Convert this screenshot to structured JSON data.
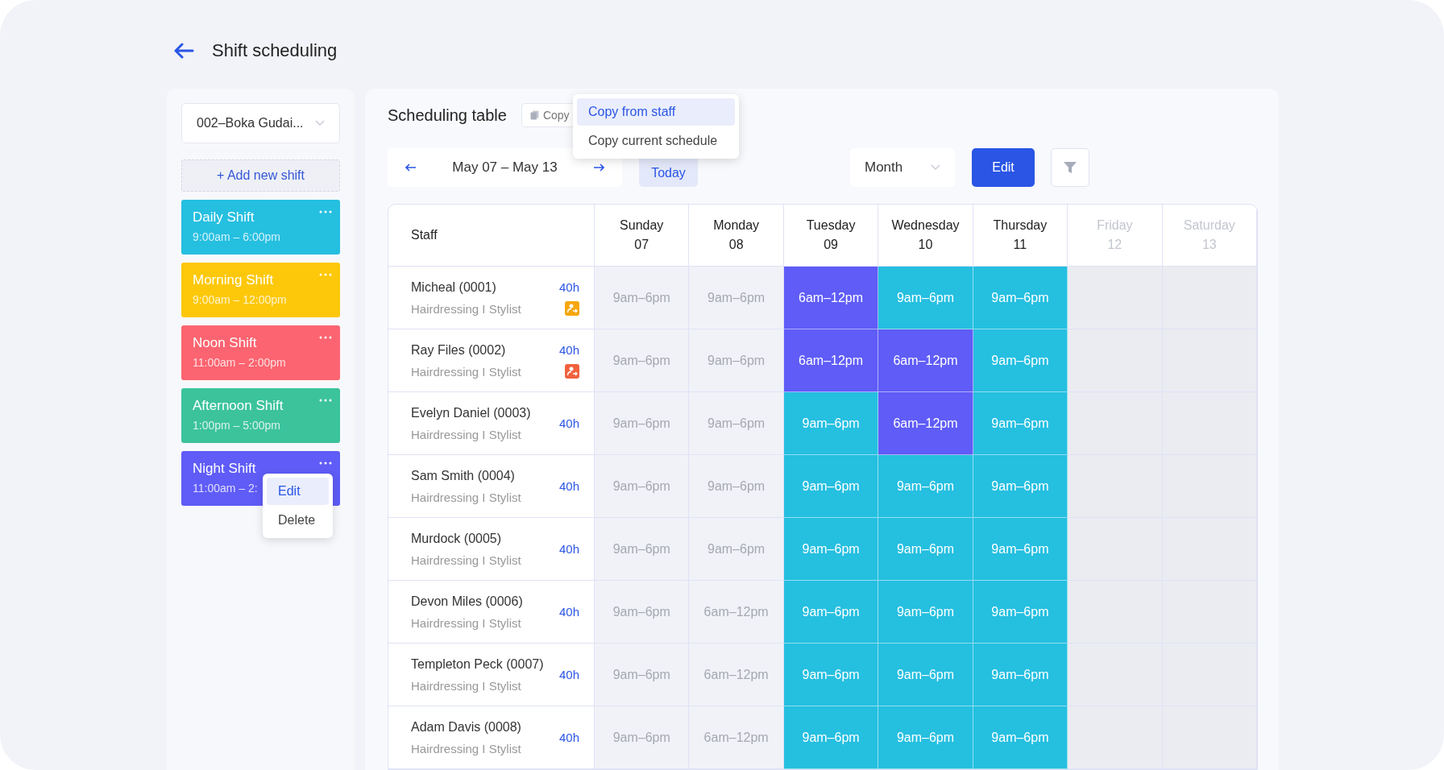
{
  "header": {
    "title": "Shift scheduling"
  },
  "sidebar": {
    "store_select": "002–Boka Gudai...",
    "add_button": "+ Add new shift",
    "shifts": [
      {
        "name": "Daily Shift",
        "time": "9:00am – 6:00pm",
        "color": "#25bfe0"
      },
      {
        "name": "Morning Shift",
        "time": "9:00am – 12:00pm",
        "color": "#fdc80a"
      },
      {
        "name": "Noon Shift",
        "time": "11:00am – 2:00pm",
        "color": "#fb6470"
      },
      {
        "name": "Afternoon Shift",
        "time": "1:00pm – 5:00pm",
        "color": "#3cc39c"
      },
      {
        "name": "Night Shift",
        "time": "11:00am – 2:",
        "color": "#5f5cf7",
        "menu": [
          {
            "label": "Edit",
            "selected": true
          },
          {
            "label": "Delete",
            "selected": false
          }
        ]
      }
    ]
  },
  "main": {
    "title": "Scheduling table",
    "copy_button": "Copy",
    "copy_menu": [
      {
        "label": "Copy from staff",
        "selected": true
      },
      {
        "label": "Copy current schedule",
        "selected": false
      }
    ],
    "range": "May 07 – May 13",
    "today_button": "Today",
    "view_select": "Month",
    "edit_button": "Edit",
    "table": {
      "staff_header": "Staff",
      "days": [
        {
          "name": "Sunday",
          "date": "07",
          "disabled": false
        },
        {
          "name": "Monday",
          "date": "08",
          "disabled": false
        },
        {
          "name": "Tuesday",
          "date": "09",
          "disabled": false
        },
        {
          "name": "Wednesday",
          "date": "10",
          "disabled": false
        },
        {
          "name": "Thursday",
          "date": "11",
          "disabled": false
        },
        {
          "name": "Friday",
          "date": "12",
          "disabled": true
        },
        {
          "name": "Saturday",
          "date": "13",
          "disabled": true
        }
      ],
      "staff": [
        {
          "name": "Micheal (0001)",
          "role": "Hairdressing I Stylist",
          "hours": "40h",
          "badge": {
            "color": "#f6a60f"
          },
          "cells": [
            {
              "kind": "past",
              "text": "9am–6pm"
            },
            {
              "kind": "past",
              "text": "9am–6pm"
            },
            {
              "kind": "shift",
              "text": "6am–12pm",
              "color": "#5f5cf7"
            },
            {
              "kind": "shift",
              "text": "9am–6pm",
              "color": "#25bfe0"
            },
            {
              "kind": "shift",
              "text": "9am–6pm",
              "color": "#25bfe0"
            },
            {
              "kind": "empty"
            },
            {
              "kind": "empty"
            }
          ]
        },
        {
          "name": "Ray Files (0002)",
          "role": "Hairdressing I Stylist",
          "hours": "40h",
          "badge": {
            "color": "#f2613d"
          },
          "cells": [
            {
              "kind": "past",
              "text": "9am–6pm"
            },
            {
              "kind": "past",
              "text": "9am–6pm"
            },
            {
              "kind": "shift",
              "text": "6am–12pm",
              "color": "#5f5cf7"
            },
            {
              "kind": "shift",
              "text": "6am–12pm",
              "color": "#5f5cf7"
            },
            {
              "kind": "shift",
              "text": "9am–6pm",
              "color": "#25bfe0"
            },
            {
              "kind": "empty"
            },
            {
              "kind": "empty"
            }
          ]
        },
        {
          "name": "Evelyn Daniel (0003)",
          "role": "Hairdressing I Stylist",
          "hours": "40h",
          "cells": [
            {
              "kind": "past",
              "text": "9am–6pm"
            },
            {
              "kind": "past",
              "text": "9am–6pm"
            },
            {
              "kind": "shift",
              "text": "9am–6pm",
              "color": "#25bfe0"
            },
            {
              "kind": "shift",
              "text": "6am–12pm",
              "color": "#5f5cf7"
            },
            {
              "kind": "shift",
              "text": "9am–6pm",
              "color": "#25bfe0"
            },
            {
              "kind": "empty"
            },
            {
              "kind": "empty"
            }
          ]
        },
        {
          "name": "Sam Smith (0004)",
          "role": "Hairdressing I Stylist",
          "hours": "40h",
          "cells": [
            {
              "kind": "past",
              "text": "9am–6pm"
            },
            {
              "kind": "past",
              "text": "9am–6pm"
            },
            {
              "kind": "shift",
              "text": "9am–6pm",
              "color": "#25bfe0"
            },
            {
              "kind": "shift",
              "text": "9am–6pm",
              "color": "#25bfe0"
            },
            {
              "kind": "shift",
              "text": "9am–6pm",
              "color": "#25bfe0"
            },
            {
              "kind": "empty"
            },
            {
              "kind": "empty"
            }
          ]
        },
        {
          "name": "Murdock (0005)",
          "role": "Hairdressing I Stylist",
          "hours": "40h",
          "cells": [
            {
              "kind": "past",
              "text": "9am–6pm"
            },
            {
              "kind": "past",
              "text": "9am–6pm"
            },
            {
              "kind": "shift",
              "text": "9am–6pm",
              "color": "#25bfe0"
            },
            {
              "kind": "shift",
              "text": "9am–6pm",
              "color": "#25bfe0"
            },
            {
              "kind": "shift",
              "text": "9am–6pm",
              "color": "#25bfe0"
            },
            {
              "kind": "empty"
            },
            {
              "kind": "empty"
            }
          ]
        },
        {
          "name": "Devon Miles (0006)",
          "role": "Hairdressing I Stylist",
          "hours": "40h",
          "cells": [
            {
              "kind": "past",
              "text": "9am–6pm"
            },
            {
              "kind": "past",
              "text": "6am–12pm"
            },
            {
              "kind": "shift",
              "text": "9am–6pm",
              "color": "#25bfe0"
            },
            {
              "kind": "shift",
              "text": "9am–6pm",
              "color": "#25bfe0"
            },
            {
              "kind": "shift",
              "text": "9am–6pm",
              "color": "#25bfe0"
            },
            {
              "kind": "empty"
            },
            {
              "kind": "empty"
            }
          ]
        },
        {
          "name": "Templeton Peck (0007)",
          "role": "Hairdressing I Stylist",
          "hours": "40h",
          "cells": [
            {
              "kind": "past",
              "text": "9am–6pm"
            },
            {
              "kind": "past",
              "text": "6am–12pm"
            },
            {
              "kind": "shift",
              "text": "9am–6pm",
              "color": "#25bfe0"
            },
            {
              "kind": "shift",
              "text": "9am–6pm",
              "color": "#25bfe0"
            },
            {
              "kind": "shift",
              "text": "9am–6pm",
              "color": "#25bfe0"
            },
            {
              "kind": "empty"
            },
            {
              "kind": "empty"
            }
          ]
        },
        {
          "name": "Adam Davis (0008)",
          "role": "Hairdressing I Stylist",
          "hours": "40h",
          "cells": [
            {
              "kind": "past",
              "text": "9am–6pm"
            },
            {
              "kind": "past",
              "text": "6am–12pm"
            },
            {
              "kind": "shift",
              "text": "9am–6pm",
              "color": "#25bfe0"
            },
            {
              "kind": "shift",
              "text": "9am–6pm",
              "color": "#25bfe0"
            },
            {
              "kind": "shift",
              "text": "9am–6pm",
              "color": "#25bfe0"
            },
            {
              "kind": "empty"
            },
            {
              "kind": "empty"
            }
          ]
        }
      ]
    }
  }
}
